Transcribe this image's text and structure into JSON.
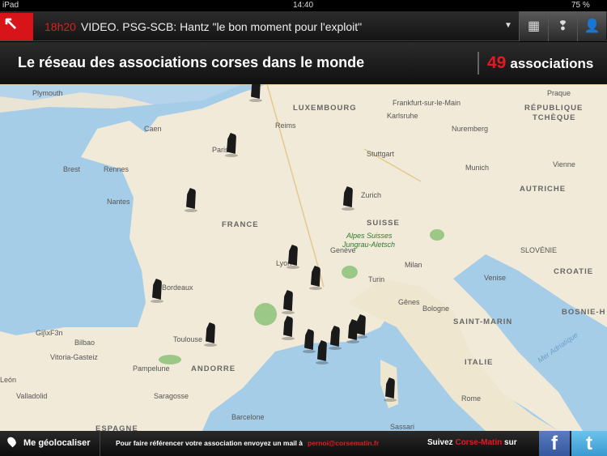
{
  "status": {
    "device": "iPad",
    "time": "14:40",
    "battery": "75 %"
  },
  "topbar": {
    "ticker_time": "18h20",
    "ticker_text": "VIDEO. PSG-SCB: Hantz \"le bon moment pour l'exploit\"",
    "icons": [
      "calendar-icon",
      "alert-icon",
      "user-icon"
    ]
  },
  "header": {
    "title": "Le réseau des associations corses dans le monde",
    "count": "49",
    "count_label": "associations"
  },
  "map": {
    "labels": [
      "Plymouth",
      "LUXEMBOURG",
      "Frankfurt-sur-le-Main",
      "RÉPUBLIQUE",
      "TCHÈQUE",
      "Caen",
      "Reims",
      "Karlsruhe",
      "Nuremberg",
      "Paris",
      "Stuttgart",
      "Brest",
      "Rennes",
      "Munich",
      "Vienne",
      "Nantes",
      "Zurich",
      "AUTRICHE",
      "FRANCE",
      "SUISSE",
      "Alpes Suisses",
      "Jungrau-Aletsch",
      "Genève",
      "SLOVÉNIE",
      "Lyon",
      "Milan",
      "Venise",
      "CROATIE",
      "Turin",
      "Bordeaux",
      "Gênes",
      "Bologne",
      "BOSNIE-H",
      "Toulouse",
      "SAINT-MARIN",
      "Gij\\xF3n",
      "Bilbao",
      "Vitoria-Gasteiz",
      "Pampelune",
      "ANDORRE",
      "ITALIE",
      "Mer Adriatique",
      "León",
      "Valladolid",
      "Saragosse",
      "Rome",
      "ESPAGNE",
      "Barcelone",
      "Sassari",
      "Praque"
    ],
    "accent": "#e21b22"
  },
  "footer": {
    "geolocate": "Me géolocaliser",
    "info": "Pour faire référencer votre association envoyez un mail à",
    "email": "pernoi@corsematin.fr",
    "follow": "Suivez",
    "brand": "Corse-Matin",
    "follow_end": "sur",
    "facebook": "f",
    "twitter": "t"
  }
}
